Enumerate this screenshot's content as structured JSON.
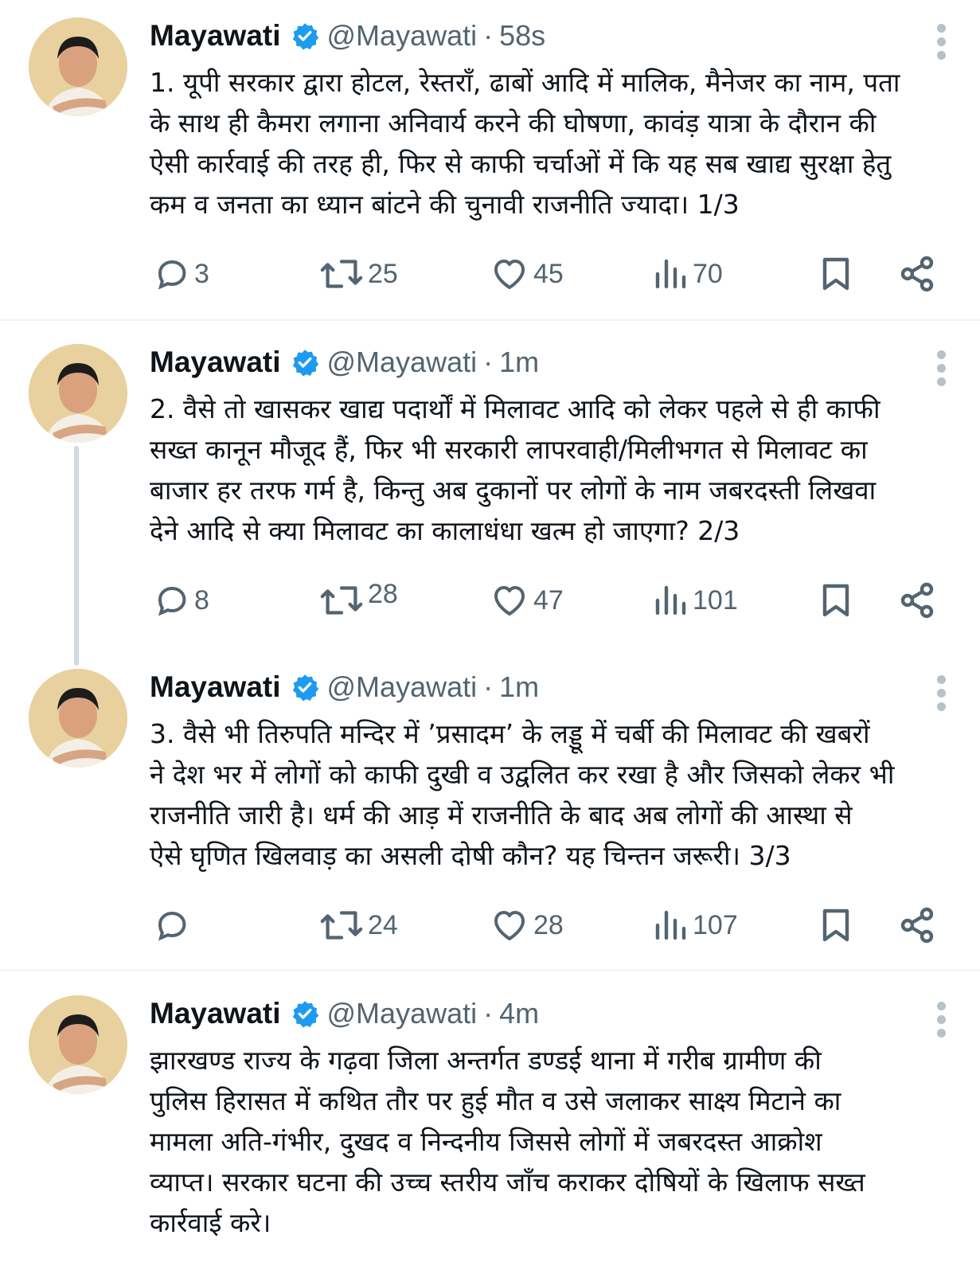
{
  "colors": {
    "text": "#0f1419",
    "secondary": "#536471",
    "verified": "#1d9bf0",
    "divider": "#eff3f4",
    "thread_line": "#cfd9de"
  },
  "icons": {
    "reply": "reply-icon",
    "retweet": "retweet-icon",
    "like": "like-icon",
    "views": "views-icon",
    "bookmark": "bookmark-icon",
    "share": "share-icon",
    "more": "more-icon",
    "verified": "verified-badge-icon"
  },
  "tweets": [
    {
      "name": "Mayawati",
      "handle": "@Mayawati",
      "separator": "·",
      "time": "58s",
      "text": "1. यूपी सरकार द्वारा होटल, रेस्तराँ, ढाबों आदि में मालिक, मैनेजर का नाम, पता\nके साथ ही कैमरा लगाना अनिवार्य करने की घोषणा, कावंड़ यात्रा के दौरान की\nऐसी कार्रवाई की तरह ही, फिर से काफी चर्चाओं में कि यह सब खाद्य सुरक्षा हेतु\nकम व जनता का ध्यान बांटने की चुनावी राजनीति ज्यादा। 1/3",
      "replies": "3",
      "retweets": "25",
      "likes": "45",
      "views": "70"
    },
    {
      "name": "Mayawati",
      "handle": "@Mayawati",
      "separator": "·",
      "time": "1m",
      "text": "2. वैसे तो खासकर खाद्य पदार्थों में मिलावट आदि को लेकर पहले से ही काफी\nसख्त कानून मौजूद हैं, फिर भी सरकारी लापरवाही/मिलीभगत से मिलावट का\nबाजार हर तरफ गर्म है, किन्तु अब दुकानों पर लोगों के नाम जबरदस्ती लिखवा\nदेने आदि से क्या मिलावट का कालाधंधा खत्म हो जाएगा? 2/3",
      "replies": "8",
      "retweets": "28",
      "likes": "47",
      "views": "101"
    },
    {
      "name": "Mayawati",
      "handle": "@Mayawati",
      "separator": "·",
      "time": "1m",
      "text": "3. वैसे भी तिरुपति मन्दिर में ’प्रसादम’ के लड्डू में चर्बी की मिलावट की खबरों\nने देश भर में लोगों को काफी दुखी व उद्वलित कर रखा है और जिसको लेकर भी\nराजनीति जारी है। धर्म की आड़ में राजनीति के बाद अब लोगों की आस्था से\nऐसे घृणित खिलवाड़ का असली दोषी कौन? यह चिन्तन जरूरी। 3/3",
      "replies": "",
      "retweets": "24",
      "likes": "28",
      "views": "107"
    },
    {
      "name": "Mayawati",
      "handle": "@Mayawati",
      "separator": "·",
      "time": "4m",
      "text": "झारखण्ड राज्य के गढ़वा जिला अन्तर्गत डण्डई थाना में गरीब ग्रामीण की\nपुलिस हिरासत में कथित तौर पर हुई मौत व उसे जलाकर साक्ष्य मिटाने का\nमामला अति-गंभीर, दुखद व निन्दनीय जिससे लोगों में जबरदस्त आक्रोश\nव्याप्त। सरकार घटना की उच्च स्तरीय जाँच कराकर दोषियों के खिलाफ सख्त\nकार्रवाई करे।"
    }
  ]
}
